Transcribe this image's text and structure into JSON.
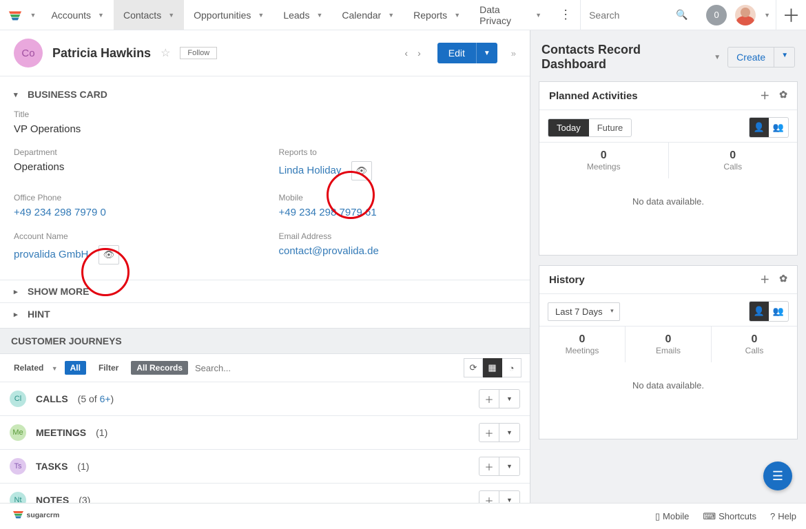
{
  "nav": {
    "items": [
      {
        "label": "Accounts"
      },
      {
        "label": "Contacts"
      },
      {
        "label": "Opportunities"
      },
      {
        "label": "Leads"
      },
      {
        "label": "Calendar"
      },
      {
        "label": "Reports"
      },
      {
        "label": "Data Privacy"
      }
    ],
    "active_index": 1,
    "search_placeholder": "Search",
    "notif_count": "0"
  },
  "record": {
    "avatar_initials": "Co",
    "name": "Patricia Hawkins",
    "follow_label": "Follow",
    "edit_label": "Edit"
  },
  "business_card": {
    "section_label": "BUSINESS CARD",
    "fields": {
      "title_label": "Title",
      "title_value": "VP Operations",
      "department_label": "Department",
      "department_value": "Operations",
      "reports_to_label": "Reports to",
      "reports_to_value": "Linda Holiday",
      "office_phone_label": "Office Phone",
      "office_phone_value": "+49 234 298 7979 0",
      "mobile_label": "Mobile",
      "mobile_value": "+49 234 298 7979 61",
      "account_label": "Account Name",
      "account_value": "provalida GmbH",
      "email_label": "Email Address",
      "email_value": "contact@provalida.de"
    }
  },
  "sections": {
    "show_more": "SHOW MORE",
    "hint": "HINT",
    "customer_journeys": "CUSTOMER JOURNEYS"
  },
  "journeys_toolbar": {
    "related_label": "Related",
    "all_badge": "All",
    "filter_label": "Filter",
    "all_records_badge": "All Records",
    "search_placeholder": "Search..."
  },
  "subpanels": [
    {
      "abbr": "Cl",
      "abbr_bg": "#b8e6e0",
      "abbr_fg": "#2a9187",
      "title": "CALLS",
      "count_prefix": "(5 of ",
      "count_link": "6+",
      "count_suffix": ")"
    },
    {
      "abbr": "Me",
      "abbr_bg": "#c9e7b8",
      "abbr_fg": "#5a9a3a",
      "title": "MEETINGS",
      "count_prefix": "(1)",
      "count_link": "",
      "count_suffix": ""
    },
    {
      "abbr": "Ts",
      "abbr_bg": "#e0c8ef",
      "abbr_fg": "#8a5bb3",
      "title": "TASKS",
      "count_prefix": "(1)",
      "count_link": "",
      "count_suffix": ""
    },
    {
      "abbr": "Nt",
      "abbr_bg": "#b8e6e0",
      "abbr_fg": "#2a9187",
      "title": "NOTES",
      "count_prefix": "(3)",
      "count_link": "",
      "count_suffix": ""
    }
  ],
  "right": {
    "dashboard_title": "Contacts Record Dashboard",
    "create_label": "Create",
    "planned": {
      "title": "Planned Activities",
      "tab_today": "Today",
      "tab_future": "Future",
      "stats": [
        {
          "num": "0",
          "lbl": "Meetings"
        },
        {
          "num": "0",
          "lbl": "Calls"
        }
      ],
      "no_data": "No data available."
    },
    "history": {
      "title": "History",
      "range": "Last 7 Days",
      "stats": [
        {
          "num": "0",
          "lbl": "Meetings"
        },
        {
          "num": "0",
          "lbl": "Emails"
        },
        {
          "num": "0",
          "lbl": "Calls"
        }
      ],
      "no_data": "No data available."
    }
  },
  "footer": {
    "mobile": "Mobile",
    "shortcuts": "Shortcuts",
    "help": "Help"
  }
}
